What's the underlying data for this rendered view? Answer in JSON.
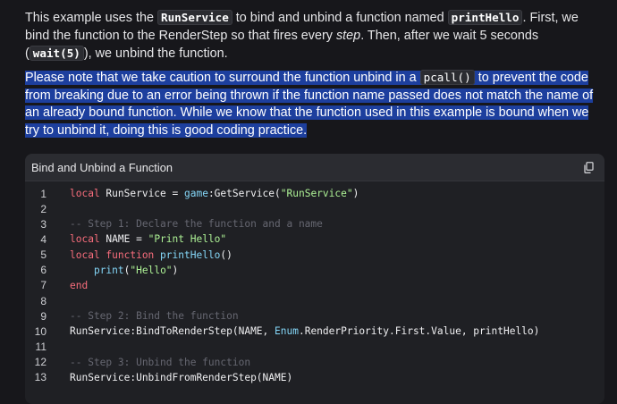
{
  "intro": {
    "t1": "This example uses the ",
    "code_runservice": "RunService",
    "t2": " to bind and unbind a function named ",
    "code_printhello": "printHello",
    "t3": ". First, we bind the function to the RenderStep so that fires every ",
    "em_step": "step",
    "t4": ". Then, after we wait 5 seconds (",
    "code_wait": "wait(5)",
    "t5": "), we unbind the function."
  },
  "note": {
    "t1": "Please note that we take caution to surround the function unbind in a ",
    "code_pcall": "pcall()",
    "t2": " to prevent the code from breaking due to an error being thrown if the function name passed does not match the name of an already bound function. While we know that the function used in this example is bound when we try to unbind it, doing this is good coding practice."
  },
  "code_block": {
    "title": "Bind and Unbind a Function",
    "copy_icon": "copy-icon",
    "lines": [
      {
        "n": "1",
        "tokens": [
          [
            "kw",
            "local"
          ],
          [
            "p",
            " RunService = "
          ],
          [
            "fn",
            "game"
          ],
          [
            "p",
            ":GetService("
          ],
          [
            "str",
            "\"RunService\""
          ],
          [
            "p",
            ")"
          ]
        ]
      },
      {
        "n": "2",
        "tokens": []
      },
      {
        "n": "3",
        "tokens": [
          [
            "cm",
            "-- Step 1: Declare the function and a name"
          ]
        ]
      },
      {
        "n": "4",
        "tokens": [
          [
            "kw",
            "local"
          ],
          [
            "p",
            " NAME = "
          ],
          [
            "str",
            "\"Print Hello\""
          ]
        ]
      },
      {
        "n": "5",
        "tokens": [
          [
            "kw",
            "local function"
          ],
          [
            "p",
            " "
          ],
          [
            "fn",
            "printHello"
          ],
          [
            "p",
            "()"
          ]
        ]
      },
      {
        "n": "6",
        "tokens": [
          [
            "p",
            "    "
          ],
          [
            "bi",
            "print"
          ],
          [
            "p",
            "("
          ],
          [
            "str",
            "\"Hello\""
          ],
          [
            "p",
            ")"
          ]
        ]
      },
      {
        "n": "7",
        "tokens": [
          [
            "kw",
            "end"
          ]
        ]
      },
      {
        "n": "8",
        "tokens": []
      },
      {
        "n": "9",
        "tokens": [
          [
            "cm",
            "-- Step 2: Bind the function"
          ]
        ]
      },
      {
        "n": "10",
        "tokens": [
          [
            "p",
            "RunService:BindToRenderStep(NAME, "
          ],
          [
            "fn",
            "Enum"
          ],
          [
            "p",
            ".RenderPriority.First.Value, printHello)"
          ]
        ]
      },
      {
        "n": "11",
        "tokens": []
      },
      {
        "n": "12",
        "tokens": [
          [
            "cm",
            "-- Step 3: Unbind the function"
          ]
        ]
      },
      {
        "n": "13",
        "tokens": [
          [
            "p",
            "RunService:UnbindFromRenderStep(NAME)"
          ]
        ]
      }
    ]
  },
  "colors": {
    "background": "#17171b",
    "selection": "#1d3f9e",
    "keyword": "#f86d7c",
    "function": "#84d6f7",
    "string": "#adf195",
    "comment": "#666771"
  }
}
